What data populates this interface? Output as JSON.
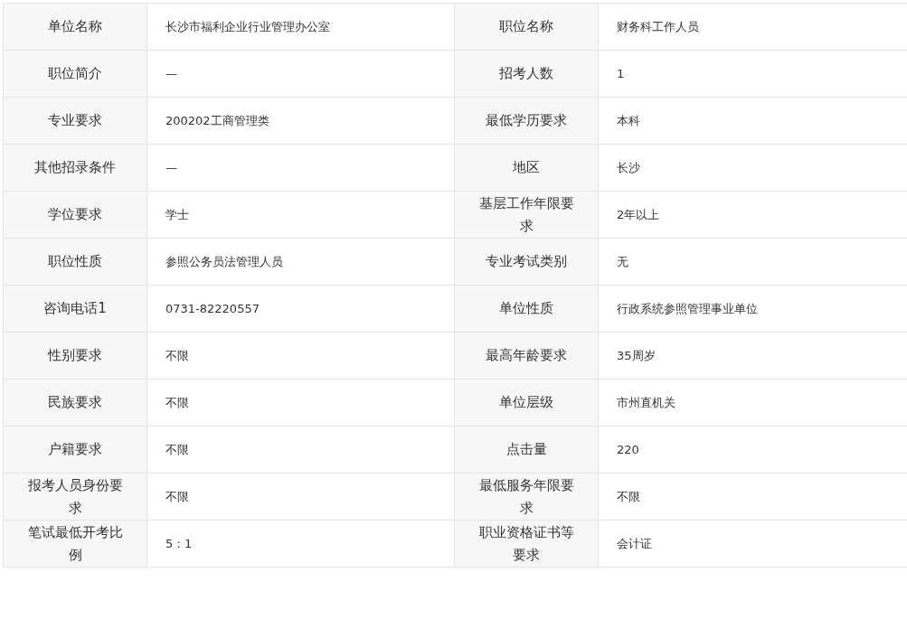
{
  "rows": [
    {
      "left": {
        "label": "单位名称",
        "value": "长沙市福利企业行业管理办公室"
      },
      "right": {
        "label": "职位名称",
        "value": "财务科工作人员"
      }
    },
    {
      "left": {
        "label": "职位简介",
        "value": "—"
      },
      "right": {
        "label": "招考人数",
        "value": "1"
      }
    },
    {
      "left": {
        "label": "专业要求",
        "value": "200202工商管理类"
      },
      "right": {
        "label": "最低学历要求",
        "value": "本科"
      }
    },
    {
      "left": {
        "label": "其他招录条件",
        "value": "—"
      },
      "right": {
        "label": "地区",
        "value": "长沙"
      }
    },
    {
      "left": {
        "label": "学位要求",
        "value": "学士"
      },
      "right": {
        "label": "基层工作年限要求",
        "value": "2年以上"
      }
    },
    {
      "left": {
        "label": "职位性质",
        "value": "参照公务员法管理人员"
      },
      "right": {
        "label": "专业考试类别",
        "value": "无"
      }
    },
    {
      "left": {
        "label": "咨询电话1",
        "value": "0731-82220557"
      },
      "right": {
        "label": "单位性质",
        "value": "行政系统参照管理事业单位"
      }
    },
    {
      "left": {
        "label": "性别要求",
        "value": "不限"
      },
      "right": {
        "label": "最高年龄要求",
        "value": "35周岁"
      }
    },
    {
      "left": {
        "label": "民族要求",
        "value": "不限"
      },
      "right": {
        "label": "单位层级",
        "value": "市州直机关"
      }
    },
    {
      "left": {
        "label": "户籍要求",
        "value": "不限"
      },
      "right": {
        "label": "点击量",
        "value": "220"
      }
    },
    {
      "left": {
        "label": "报考人员身份要求",
        "value": "不限"
      },
      "right": {
        "label": "最低服务年限要求",
        "value": "不限"
      }
    },
    {
      "left": {
        "label": "笔试最低开考比例",
        "value": "5 : 1"
      },
      "right": {
        "label": "职业资格证书等要求",
        "value": "会计证"
      }
    }
  ]
}
